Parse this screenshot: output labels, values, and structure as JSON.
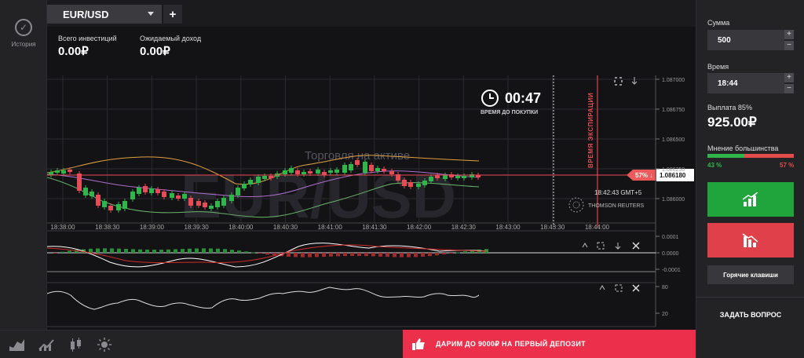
{
  "sidebar": {
    "history_label": "История"
  },
  "tabs": {
    "asset": "EUR/USD",
    "add_label": "+"
  },
  "stats": {
    "invest_label": "Всего инвестиций",
    "invest_value": "0.00₽",
    "income_label": "Ожидаемый доход",
    "income_value": "0.00₽"
  },
  "timer": {
    "value": "00:47",
    "label": "ВРЕМЯ ДО ПОКУПКИ"
  },
  "chart": {
    "expiration_label": "ВРЕМЯ ЭКСПИРАЦИИ",
    "watermark": "EUR/USD",
    "trading_label": "Торговля на активе",
    "current_price": "1.086180",
    "current_pct": "57% ↓",
    "gmt_time": "18:42:43 GMT+5",
    "provider": "THOMSON REUTERS",
    "y_ticks": [
      "1.087000",
      "1.086750",
      "1.086500",
      "1.086250",
      "1.086000"
    ],
    "x_ticks": [
      "18:38:00",
      "18:38:30",
      "18:39:00",
      "18:39:30",
      "18:40:00",
      "18:40:30",
      "18:41:00",
      "18:41:30",
      "18:42:00",
      "18:42:30",
      "18:43:00",
      "18:43:30",
      "18:44:00"
    ],
    "macd_ticks": [
      "0.0001",
      "0.0000",
      "-0.0001"
    ],
    "rsi_ticks": [
      "80",
      "20"
    ]
  },
  "panel": {
    "amount_label": "Сумма",
    "amount_value": "500",
    "time_label": "Время",
    "time_value": "18:44",
    "payout_label": "Выплата 85%",
    "payout_value": "925.00₽",
    "opinion_label": "Мнение большинства",
    "opinion_up": "43 %",
    "opinion_down": "57 %",
    "hotkeys_label": "Горячие клавиши",
    "ask_label": "ЗАДАТЬ ВОПРОС"
  },
  "promo": {
    "text": "ДАРИМ ДО 9000₽ НА ПЕРВЫЙ ДЕПОЗИТ"
  },
  "colors": {
    "up": "#20a53c",
    "down": "#e04049",
    "accent_red": "#ec2f4a"
  }
}
